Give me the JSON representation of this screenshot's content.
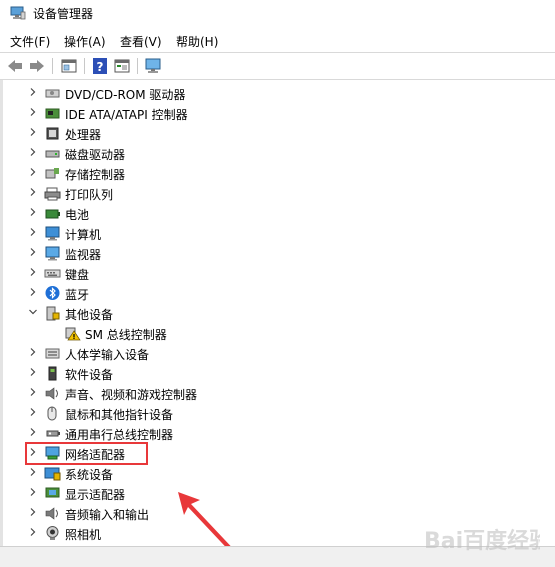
{
  "window": {
    "title": "设备管理器"
  },
  "menu": [
    {
      "label": "文件(F)"
    },
    {
      "label": "操作(A)"
    },
    {
      "label": "查看(V)"
    },
    {
      "label": "帮助(H)"
    }
  ],
  "toolbar": [
    "back-icon",
    "forward-icon",
    "properties-icon",
    "help-icon",
    "view-icon",
    "monitor-scan-icon"
  ],
  "tree": [
    {
      "label": "DVD/CD-ROM 驱动器",
      "icon": "dvd-drive-icon",
      "state": "collapsed"
    },
    {
      "label": "IDE ATA/ATAPI 控制器",
      "icon": "ide-controller-icon",
      "state": "collapsed"
    },
    {
      "label": "处理器",
      "icon": "processor-icon",
      "state": "collapsed"
    },
    {
      "label": "磁盘驱动器",
      "icon": "disk-drive-icon",
      "state": "collapsed"
    },
    {
      "label": "存储控制器",
      "icon": "storage-controller-icon",
      "state": "collapsed"
    },
    {
      "label": "打印队列",
      "icon": "printer-icon",
      "state": "collapsed"
    },
    {
      "label": "电池",
      "icon": "battery-icon",
      "state": "collapsed"
    },
    {
      "label": "计算机",
      "icon": "computer-icon",
      "state": "collapsed"
    },
    {
      "label": "监视器",
      "icon": "monitor-icon",
      "state": "collapsed"
    },
    {
      "label": "键盘",
      "icon": "keyboard-icon",
      "state": "collapsed"
    },
    {
      "label": "蓝牙",
      "icon": "bluetooth-icon",
      "state": "collapsed"
    },
    {
      "label": "其他设备",
      "icon": "other-devices-icon",
      "state": "expanded"
    },
    {
      "label": "SM 总线控制器",
      "icon": "warning-device-icon",
      "state": "leaf"
    },
    {
      "label": "人体学输入设备",
      "icon": "hid-icon",
      "state": "collapsed"
    },
    {
      "label": "软件设备",
      "icon": "software-device-icon",
      "state": "collapsed"
    },
    {
      "label": "声音、视频和游戏控制器",
      "icon": "speaker-icon",
      "state": "collapsed"
    },
    {
      "label": "鼠标和其他指针设备",
      "icon": "mouse-icon",
      "state": "collapsed"
    },
    {
      "label": "通用串行总线控制器",
      "icon": "usb-icon",
      "state": "collapsed"
    },
    {
      "label": "网络适配器",
      "icon": "network-adapter-icon",
      "state": "collapsed"
    },
    {
      "label": "系统设备",
      "icon": "system-device-icon",
      "state": "collapsed"
    },
    {
      "label": "显示适配器",
      "icon": "display-adapter-icon",
      "state": "collapsed"
    },
    {
      "label": "音频输入和输出",
      "icon": "audio-io-icon",
      "state": "collapsed"
    },
    {
      "label": "照相机",
      "icon": "camera-icon",
      "state": "collapsed"
    }
  ],
  "colors": {
    "highlight": "#e8383a",
    "arrow": "#e8383a",
    "accent": "#1e90d6"
  },
  "watermark": {
    "text": "Bai百度经验"
  }
}
